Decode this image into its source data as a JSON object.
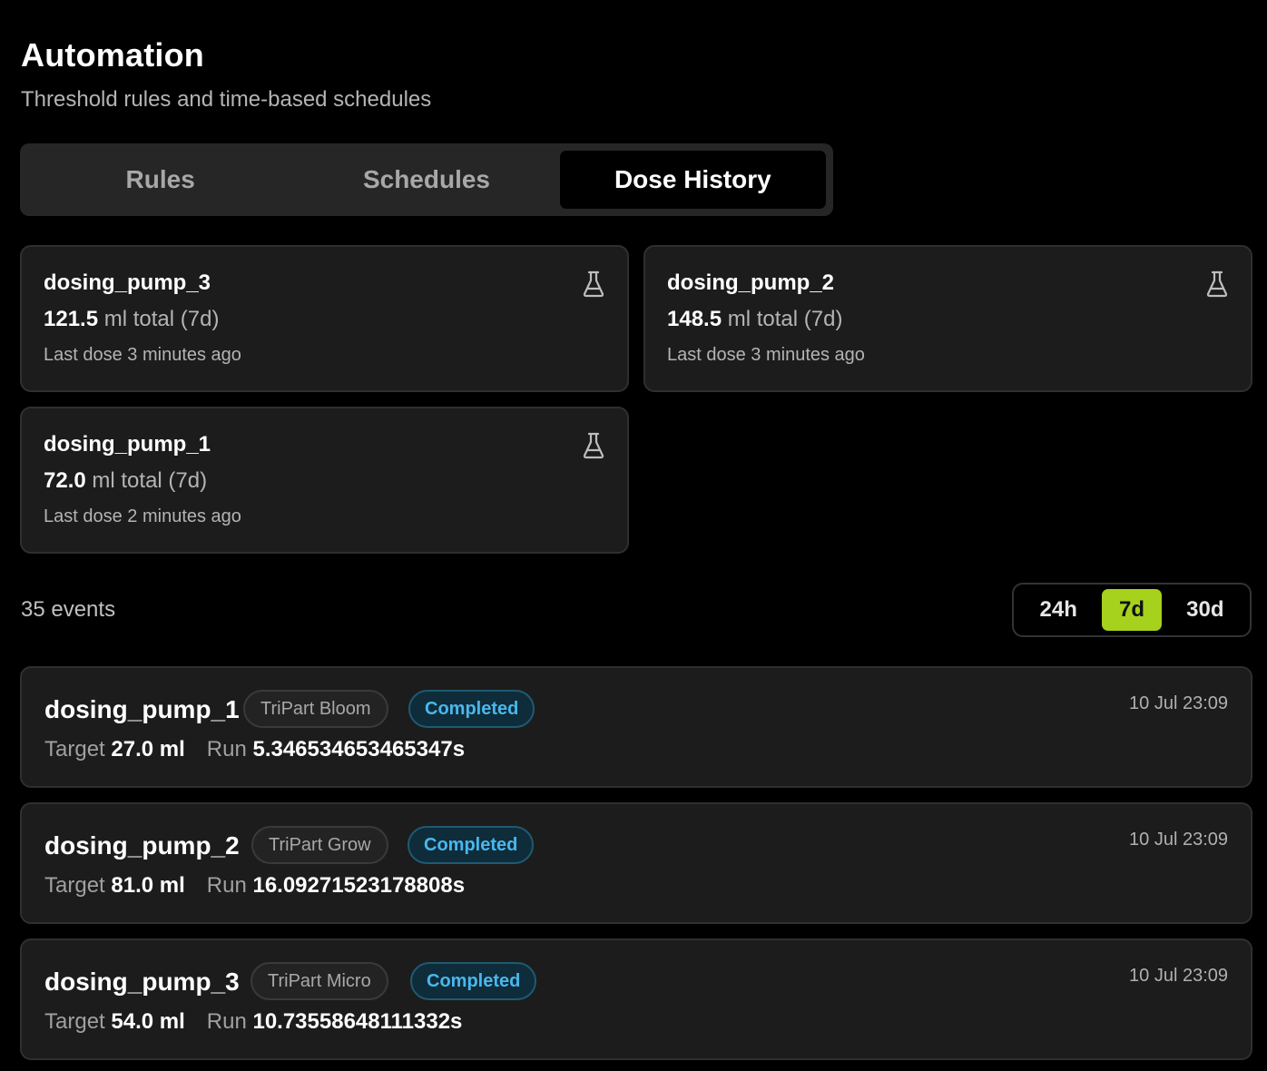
{
  "header": {
    "title": "Automation",
    "subtitle": "Threshold rules and time-based schedules"
  },
  "tabs": [
    {
      "label": "Rules",
      "active": false
    },
    {
      "label": "Schedules",
      "active": false
    },
    {
      "label": "Dose History",
      "active": true
    }
  ],
  "pumps": [
    {
      "name": "dosing_pump_3",
      "total_value": "121.5",
      "total_suffix": "ml total (7d)",
      "last_dose": "Last dose 3 minutes ago",
      "icon": "flask-icon"
    },
    {
      "name": "dosing_pump_2",
      "total_value": "148.5",
      "total_suffix": "ml total (7d)",
      "last_dose": "Last dose 3 minutes ago",
      "icon": "flask-icon"
    },
    {
      "name": "dosing_pump_1",
      "total_value": "72.0",
      "total_suffix": "ml total (7d)",
      "last_dose": "Last dose 2 minutes ago",
      "icon": "flask-icon"
    }
  ],
  "events_summary": "35 events",
  "range": {
    "options": [
      "24h",
      "7d",
      "30d"
    ],
    "selected": "7d",
    "accent": "#a6d11c"
  },
  "events": [
    {
      "pump": "dosing_pump_1",
      "product": "TriPart Bloom",
      "status": "Completed",
      "target_label": "Target",
      "target": "27.0 ml",
      "run_label": "Run",
      "run": "5.346534653465347s",
      "time": "10 Jul 23:09"
    },
    {
      "pump": "dosing_pump_2",
      "product": "TriPart Grow",
      "status": "Completed",
      "target_label": "Target",
      "target": "81.0 ml",
      "run_label": "Run",
      "run": "16.09271523178808s",
      "time": "10 Jul 23:09"
    },
    {
      "pump": "dosing_pump_3",
      "product": "TriPart Micro",
      "status": "Completed",
      "target_label": "Target",
      "target": "54.0 ml",
      "run_label": "Run",
      "run": "10.73558648111332s",
      "time": "10 Jul 23:09"
    }
  ],
  "colors": {
    "background": "#000000",
    "card": "#1c1c1c",
    "status_completed": "#48b8ee"
  }
}
